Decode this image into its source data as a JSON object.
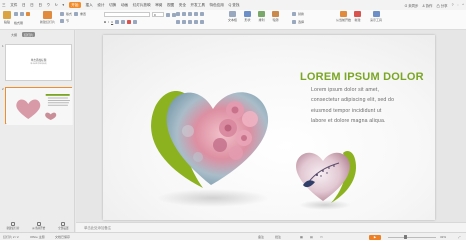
{
  "menubar": {
    "items": [
      "三",
      "文件",
      "日",
      "日",
      "日",
      "ウ",
      "↻",
      "▾",
      "开始",
      "插入",
      "设计",
      "切换",
      "动画",
      "幻灯片放映",
      "审阅",
      "视图",
      "安全",
      "开发工具",
      "特色应用",
      "Q 查找"
    ],
    "active_index": 8,
    "right": [
      "G 未同步",
      "& 协作",
      "凸 分享",
      "?",
      ":",
      "^"
    ]
  },
  "toolbar": {
    "paste": "粘贴",
    "format_painter": "格式刷",
    "new_slide": "新建幻灯片",
    "layout": "版式",
    "section": "节",
    "reset": "重置",
    "font_name": "",
    "font_size": "0",
    "bold": "B",
    "italic": "I",
    "underline": "U",
    "text_box": "文本框",
    "shape": "形状",
    "arrange": "排列",
    "outline": "轮廓",
    "replace": "替换",
    "select": "选择",
    "play": "从当前开始",
    "more": "新建",
    "styles": "演示工具"
  },
  "leftpanel": {
    "tabs": [
      "大纲",
      "幻灯片"
    ],
    "active_tab": 1,
    "slides": [
      {
        "number": "1",
        "title": "单击添加标题",
        "subtitle": "单击此处添加副标题"
      },
      {
        "number": "2",
        "title": "LOREM IPSUM DOLOR"
      }
    ],
    "selected_slide": 1,
    "bottom": [
      "新建幻灯片",
      "从当前开始",
      "全部设置"
    ]
  },
  "slide": {
    "title": "LOREM IPSUM DOLOR",
    "body_lines": [
      "Lorem ipsum dolor sit amet,",
      "consectetur adipiscing elit, sed do",
      "eiusmod tempor incididunt ut",
      "labore et dolore magna aliqua."
    ],
    "accent_color": "#86b01e"
  },
  "notes": {
    "placeholder": "单击此处添加备注"
  },
  "statusbar": {
    "slide_info": "幻灯片 2 / 2",
    "theme": "Office 主题",
    "spell": "文档已保存",
    "notes_btn": "备注",
    "comments_btn": "批注",
    "zoom": "32%"
  }
}
